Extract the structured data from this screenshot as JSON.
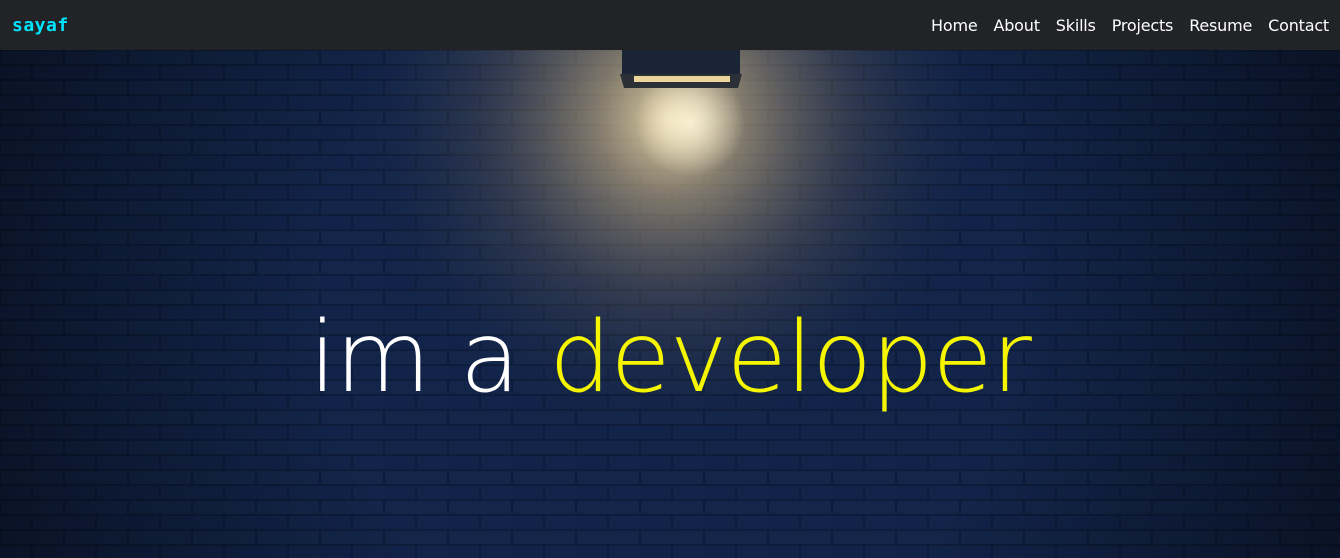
{
  "navbar": {
    "brand": "sayaf",
    "links": [
      "Home",
      "About",
      "Skills",
      "Projects",
      "Resume",
      "Contact"
    ]
  },
  "hero": {
    "prefix": "im a ",
    "highlight": "developer"
  },
  "colors": {
    "brand": "#00e5ff",
    "navbar_bg": "#212326",
    "highlight": "#f5f500",
    "text": "#ffffff",
    "wall": "#0c1a36"
  },
  "icons": [
    "wall-lamp-icon"
  ]
}
